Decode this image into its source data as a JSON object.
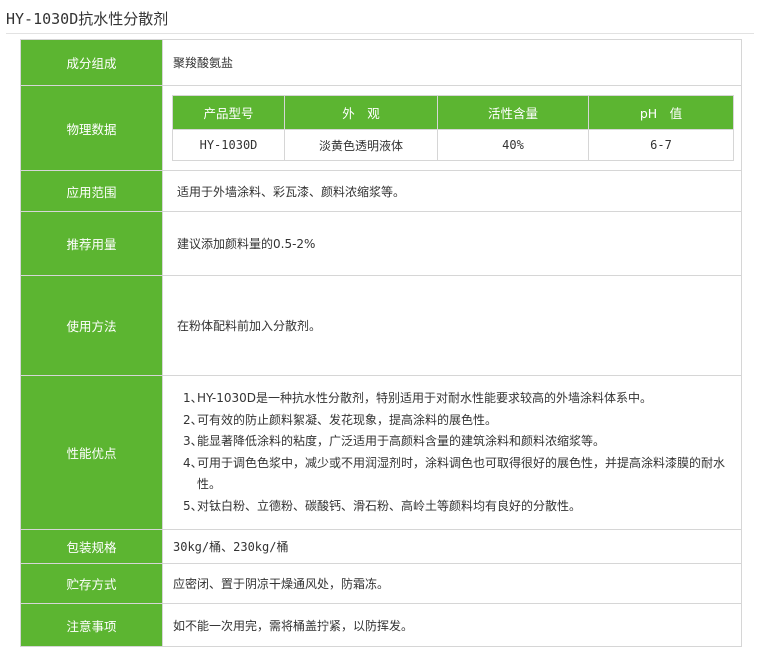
{
  "title": "HY-1030D抗水性分散剂",
  "rows": {
    "composition": {
      "label": "成分组成",
      "value": "聚羧酸氨盐"
    },
    "physical": {
      "label": "物理数据",
      "headers": [
        "产品型号",
        "外　观",
        "活性含量",
        "pH　值"
      ],
      "values": [
        "HY-1030D",
        "淡黄色透明液体",
        "40%",
        "6-7"
      ]
    },
    "scope": {
      "label": "应用范围",
      "value": "适用于外墙涂料、彩瓦漆、颜料浓缩浆等。"
    },
    "dosage": {
      "label": "推荐用量",
      "value": "建议添加颜料量的0.5-2%"
    },
    "usage": {
      "label": "使用方法",
      "value": "在粉体配料前加入分散剂。"
    },
    "advantages": {
      "label": "性能优点",
      "items": [
        {
          "num": "1、",
          "text": "HY-1030D是一种抗水性分散剂，特别适用于对耐水性能要求较高的外墙涂料体系中。"
        },
        {
          "num": "2、",
          "text": "可有效的防止颜料絮凝、发花现象，提高涂料的展色性。"
        },
        {
          "num": "3、",
          "text": "能显著降低涂料的粘度，广泛适用于高颜料含量的建筑涂料和颜料浓缩浆等。"
        },
        {
          "num": "4、",
          "text": "可用于调色色浆中，减少或不用润湿剂时，涂料调色也可取得很好的展色性，并提高涂料漆膜的耐水性。"
        },
        {
          "num": "5、",
          "text": "对钛白粉、立德粉、碳酸钙、滑石粉、高岭土等颜料均有良好的分散性。"
        }
      ]
    },
    "packaging": {
      "label": "包装规格",
      "value": "30kg/桶、230kg/桶"
    },
    "storage": {
      "label": "贮存方式",
      "value": "应密闭、置于阴凉干燥通风处，防霜冻。"
    },
    "notes": {
      "label": "注意事项",
      "value": "如不能一次用完，需将桶盖拧紧，以防挥发。"
    }
  },
  "colors": {
    "label_bg": "#5cb531",
    "label_text": "#ffffff",
    "border": "#d6d6d6",
    "text": "#333333"
  }
}
